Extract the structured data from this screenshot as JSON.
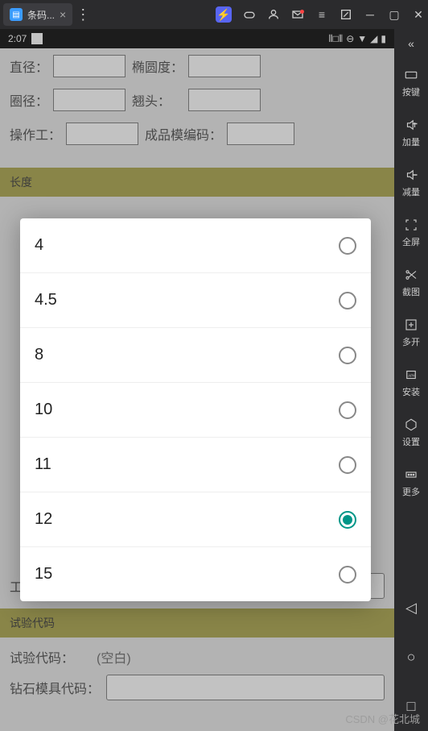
{
  "chrome": {
    "tab_title": "条码...",
    "icons": [
      "lightning",
      "game",
      "user",
      "mail",
      "menu",
      "cast",
      "minimize",
      "maximize",
      "close"
    ]
  },
  "status_bar": {
    "time": "2:07"
  },
  "form": {
    "diameter_label": "直径：",
    "ovality_label": "椭圆度：",
    "ring_diameter_label": "圈径：",
    "warp_label": "翘头：",
    "operator_label": "操作工：",
    "mold_code_label": "成品模编码：",
    "length_section": "长度",
    "process_code_label": "工艺代码：",
    "test_section": "试验代码",
    "test_code_label": "试验代码：",
    "test_code_value": "(空白)",
    "diamond_code_label": "钻石模具代码："
  },
  "dialog": {
    "options": [
      {
        "label": "4",
        "selected": false
      },
      {
        "label": "4.5",
        "selected": false
      },
      {
        "label": "8",
        "selected": false
      },
      {
        "label": "10",
        "selected": false
      },
      {
        "label": "11",
        "selected": false
      },
      {
        "label": "12",
        "selected": true
      },
      {
        "label": "15",
        "selected": false
      }
    ]
  },
  "sidebar": {
    "items": [
      {
        "label": "按键",
        "icon": "keyboard"
      },
      {
        "label": "加量",
        "icon": "vol-up"
      },
      {
        "label": "减量",
        "icon": "vol-down"
      },
      {
        "label": "全屏",
        "icon": "fullscreen"
      },
      {
        "label": "截图",
        "icon": "scissors"
      },
      {
        "label": "多开",
        "icon": "multi"
      },
      {
        "label": "安装",
        "icon": "apk"
      },
      {
        "label": "设置",
        "icon": "settings"
      },
      {
        "label": "更多",
        "icon": "more"
      }
    ]
  },
  "watermark": "CSDN @花北城"
}
